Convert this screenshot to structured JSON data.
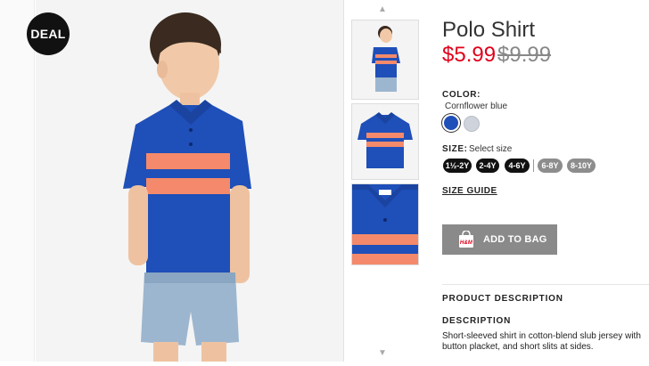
{
  "badge": "DEAL",
  "product": {
    "title": "Polo Shirt",
    "price_now": "$5.99",
    "price_was": "$9.99"
  },
  "color": {
    "label": "COLOR:",
    "selected_name": "Cornflower blue",
    "swatches": [
      {
        "name": "Cornflower blue",
        "hex": "#1f4fb8",
        "selected": true
      },
      {
        "name": "Light grey",
        "hex": "#cfd3db",
        "selected": false
      }
    ]
  },
  "size": {
    "label": "SIZE:",
    "placeholder": "Select size",
    "options": [
      {
        "label": "1½-2Y",
        "available": true
      },
      {
        "label": "2-4Y",
        "available": true
      },
      {
        "label": "4-6Y",
        "available": true
      },
      {
        "label": "6-8Y",
        "available": false
      },
      {
        "label": "8-10Y",
        "available": false
      }
    ]
  },
  "size_guide": "SIZE GUIDE",
  "add_to_bag": "ADD TO BAG",
  "sections": {
    "product_description": "PRODUCT DESCRIPTION",
    "description_label": "DESCRIPTION",
    "description_text": "Short-sleeved shirt in cotton-blend slub jersey with button placket, and short slits at sides."
  },
  "colors": {
    "price_now": "#e1001a",
    "brand_red": "#e1001a",
    "shirt_blue": "#1f4fb8",
    "stripe_coral": "#f48a6b"
  },
  "icons": [
    "chevron-up-icon",
    "chevron-down-icon",
    "shopping-bag-icon"
  ]
}
